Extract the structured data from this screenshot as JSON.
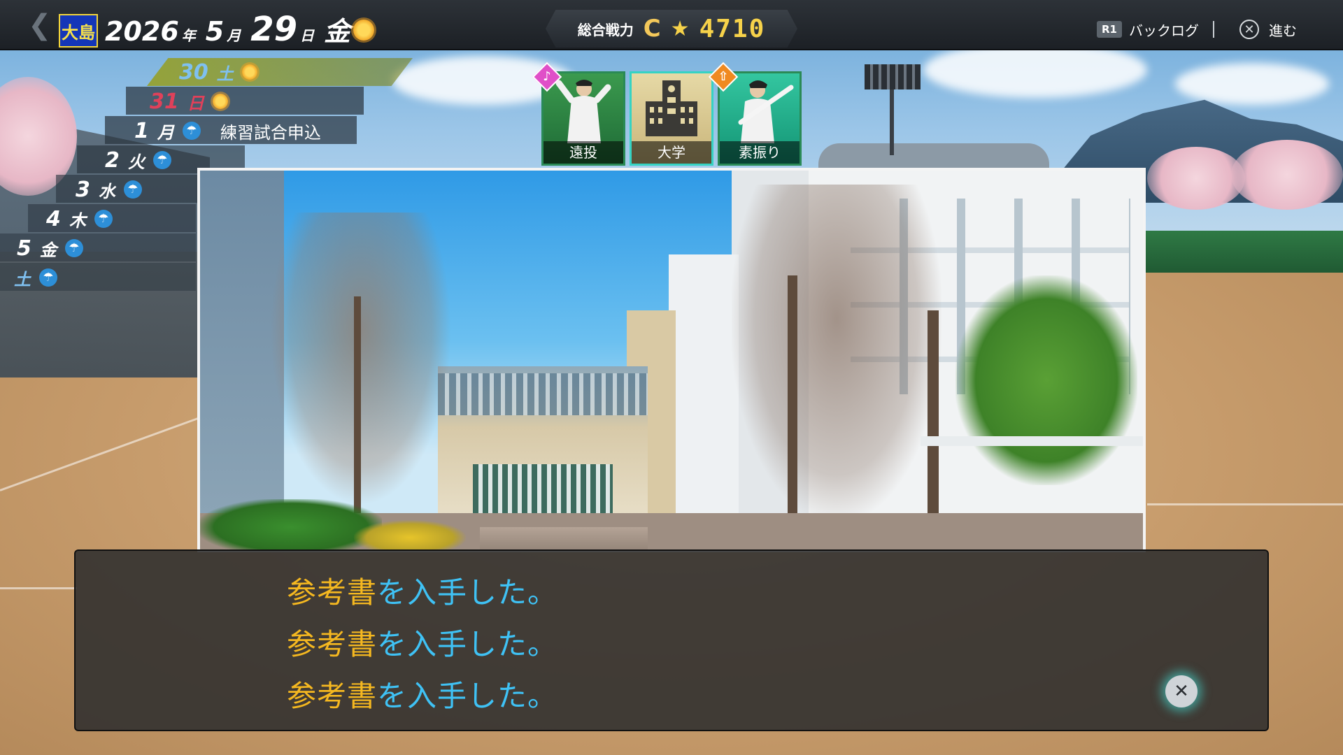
{
  "topbar": {
    "school": "大島",
    "year": "2026",
    "year_unit": "年",
    "month": "5",
    "month_unit": "月",
    "day": "29",
    "day_unit": "日",
    "weekday": "金",
    "weather": "sun-icon",
    "power_label": "総合戦力",
    "power_rank": "C",
    "power_star": "★",
    "power_value": "4710",
    "backlog_key": "R1",
    "backlog_label": "バックログ",
    "advance_key": "✕",
    "advance_label": "進む"
  },
  "calendar": [
    {
      "num": "30",
      "dow": "土",
      "weather": "sun-icon",
      "event": ""
    },
    {
      "num": "31",
      "dow": "日",
      "weather": "sun-icon",
      "event": ""
    },
    {
      "num": "1",
      "dow": "月",
      "weather": "umbrella-icon",
      "event": "練習試合申込"
    },
    {
      "num": "2",
      "dow": "火",
      "weather": "umbrella-icon",
      "event": ""
    },
    {
      "num": "3",
      "dow": "水",
      "weather": "umbrella-icon",
      "event": ""
    },
    {
      "num": "4",
      "dow": "木",
      "weather": "umbrella-icon",
      "event": ""
    },
    {
      "num": "5",
      "dow": "金",
      "weather": "umbrella-icon",
      "event": ""
    },
    {
      "num": "",
      "dow": "土",
      "weather": "umbrella-icon",
      "event": ""
    }
  ],
  "cards": [
    {
      "label": "遠投",
      "badge": "♪",
      "badge_color": "#e04fc8"
    },
    {
      "label": "大学",
      "badge": "",
      "badge_color": ""
    },
    {
      "label": "素振り",
      "badge": "⇧",
      "badge_color": "#f08a20"
    }
  ],
  "dialog": {
    "lines": [
      {
        "item": "参考書",
        "rest": "を入手した。"
      },
      {
        "item": "参考書",
        "rest": "を入手した。"
      },
      {
        "item": "参考書",
        "rest": "を入手した。"
      }
    ],
    "close_glyph": "✕"
  },
  "colors": {
    "item_text": "#f5b820",
    "message_text": "#3fc2f5",
    "sunday": "#e0415a",
    "saturday": "#7fc0f0"
  }
}
